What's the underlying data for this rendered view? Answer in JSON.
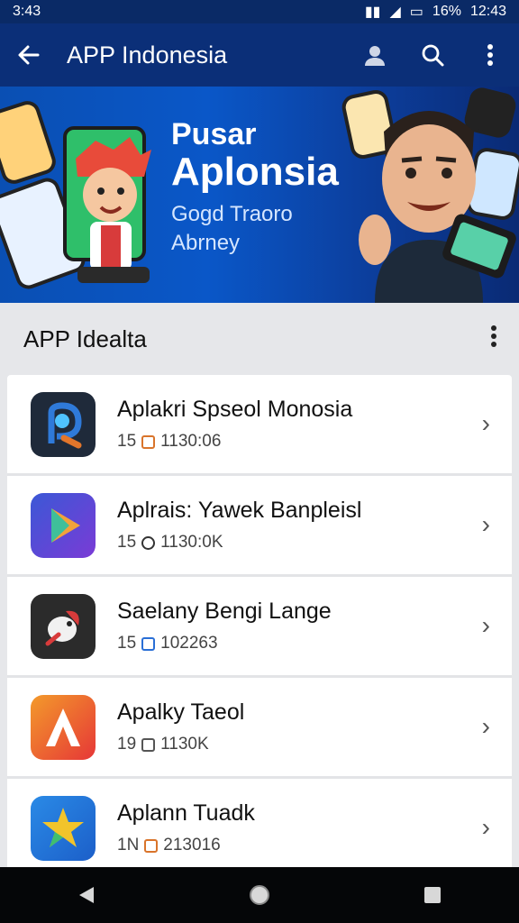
{
  "status_bar": {
    "time": "3:43",
    "battery": "16%",
    "clock": "12:43"
  },
  "app_bar": {
    "back_icon": "arrow-left-icon",
    "title": "APP Indonesia",
    "actions": [
      "account-icon",
      "search-icon",
      "more-vertical-icon"
    ]
  },
  "banner": {
    "line1": "Pusar",
    "line2": "Aplonsia",
    "line3": "Gogd Traoro",
    "line4": "Abrney"
  },
  "section": {
    "title": "APP Idealta",
    "menu_icon": "more-vertical-icon"
  },
  "apps": [
    {
      "name": "Aplakri Spseol Monosia",
      "meta": "15",
      "size": "1130:06",
      "icon": "app-icon-blue-p",
      "colors": [
        "#1f2a3a",
        "#2f7ad9",
        "#e3762b"
      ]
    },
    {
      "name": "Aplrais: Yawek Banpleisl",
      "meta": "15",
      "size": "1130:0K",
      "icon": "app-icon-play",
      "colors": [
        "#3b58d6",
        "#7a3bd6",
        "#f2a23b"
      ]
    },
    {
      "name": "Saelany Bengi Lange",
      "meta": "15",
      "size": "102263",
      "icon": "app-icon-bird",
      "colors": [
        "#2b2b2b",
        "#d83b3b",
        "#f1f1f1"
      ]
    },
    {
      "name": "Apalky Taeol",
      "meta": "19",
      "size": "1130K",
      "icon": "app-icon-letter-a",
      "colors": [
        "#e63737",
        "#f39a2b",
        "#ffffff"
      ]
    },
    {
      "name": "Aplann Tuadk",
      "meta": "1N",
      "size": "213016",
      "icon": "app-icon-star",
      "colors": [
        "#2a8ae6",
        "#f2c42b",
        "#3fbf6f"
      ]
    }
  ],
  "nav": {
    "back": "nav-back-icon",
    "home": "nav-home-icon",
    "recents": "nav-recents-icon"
  }
}
